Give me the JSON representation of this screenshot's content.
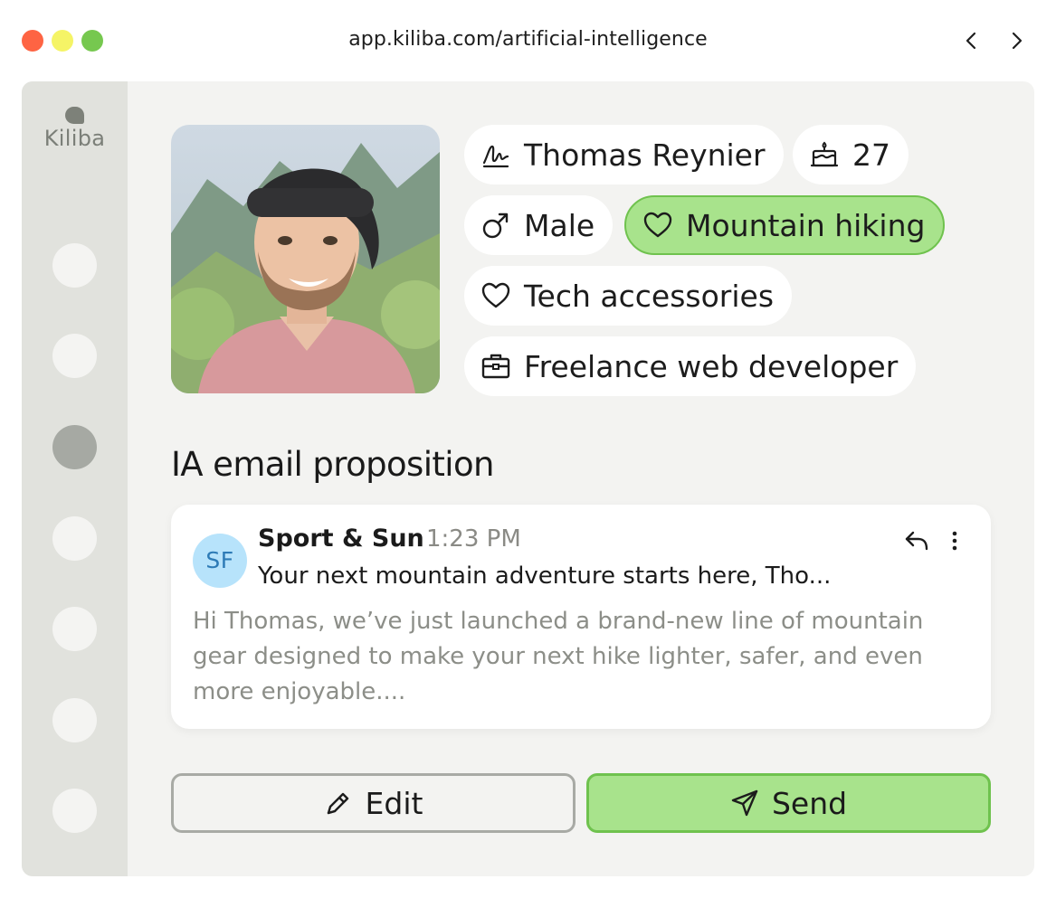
{
  "browser": {
    "url": "app.kiliba.com/artificial-intelligence",
    "back_icon": "chevron-left-icon",
    "forward_icon": "chevron-right-icon",
    "traffic_lights": [
      "#fe6443",
      "#f5f466",
      "#76c84f"
    ]
  },
  "sidebar": {
    "logo_text": "Kiliba",
    "nav_item_count": 7,
    "active_index": 2
  },
  "profile": {
    "name": "Thomas Reynier",
    "age": "27",
    "gender": "Male",
    "interests": [
      "Mountain hiking",
      "Tech accessories"
    ],
    "highlighted_interest": "Mountain hiking",
    "occupation": "Freelance web developer",
    "icons": {
      "name": "signature-icon",
      "age": "birthday-cake-icon",
      "gender": "male-symbol-icon",
      "interest": "heart-icon",
      "occupation": "briefcase-icon"
    }
  },
  "email_section": {
    "title": "IA email proposition",
    "email": {
      "avatar_initials": "SF",
      "sender": "Sport & Sun",
      "time": "1:23 PM",
      "subject": "Your next mountain adventure starts here, Tho...",
      "preview": "Hi Thomas, we’ve just launched a brand-new line of mountain gear designed to make your next hike lighter, safer, and even more enjoyable...."
    }
  },
  "actions": {
    "edit_label": "Edit",
    "send_label": "Send"
  },
  "colors": {
    "accent_green": "#a8e38c",
    "accent_green_border": "#6fc24e",
    "sidebar_bg": "#e1e2dd",
    "panel_bg": "#f3f3f1",
    "avatar_bg": "#b7e3fb",
    "avatar_text": "#2d7bb6"
  }
}
